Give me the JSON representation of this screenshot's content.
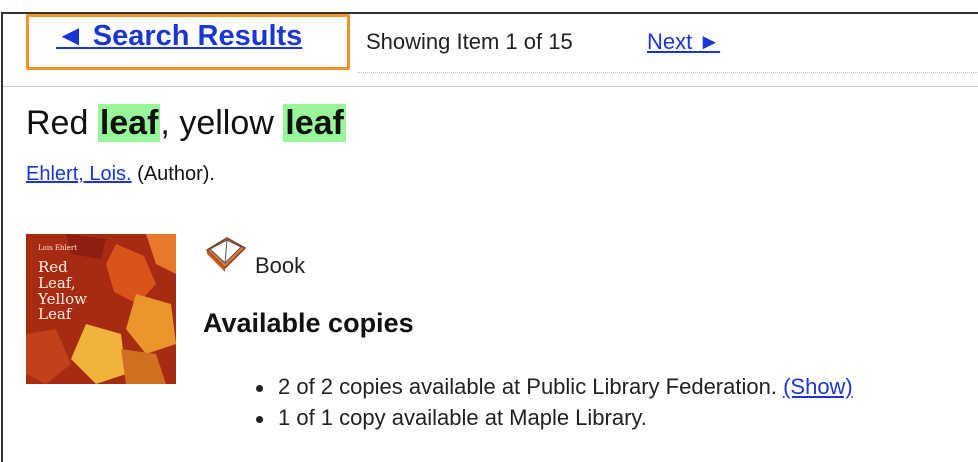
{
  "nav": {
    "back_label": "◄ Search Results",
    "showing_text": "Showing Item 1 of 15",
    "next_label": "Next ►",
    "highlight_color": "#f0922e"
  },
  "record": {
    "title_parts": [
      "Red ",
      "leaf",
      ", yellow ",
      "leaf"
    ],
    "highlight_color": "#99f599",
    "author_name": "Ehlert, Lois.",
    "author_role": "(Author)."
  },
  "cover": {
    "author": "Lois Ehlert",
    "title_lines": [
      "Red",
      "Leaf,",
      "Yellow",
      "Leaf"
    ],
    "background": "#a72a13"
  },
  "format": {
    "icon": "book-icon",
    "label": "Book"
  },
  "availability": {
    "heading": "Available copies",
    "items": [
      {
        "text": "2 of 2 copies available at Public Library Federation.",
        "link": "(Show)"
      },
      {
        "text": "1 of 1 copy available at Maple Library.",
        "link": ""
      }
    ]
  },
  "colors": {
    "link": "#1a37d6",
    "text": "#111111"
  }
}
